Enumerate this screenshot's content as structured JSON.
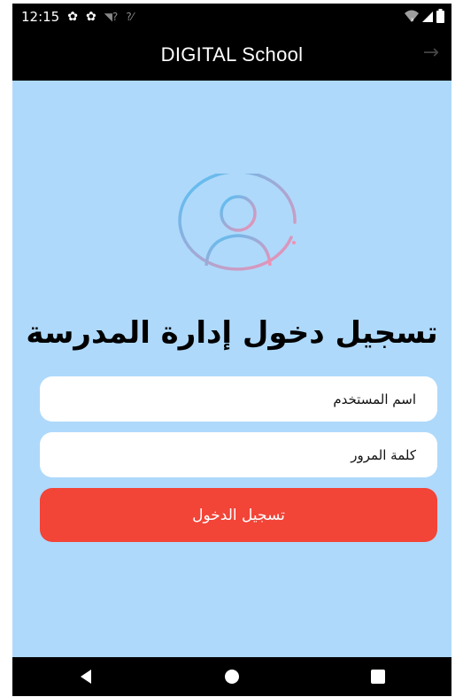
{
  "status_bar": {
    "time": "12:15",
    "icons": [
      "gear-icon",
      "gear-icon",
      "wifi-question-icon",
      "signal-question-icon"
    ],
    "right_icons": [
      "wifi-x-icon",
      "signal-icon",
      "battery-icon"
    ]
  },
  "app_bar": {
    "title": "DIGITAL School",
    "action_icon": "arrow-right-icon"
  },
  "login": {
    "heading": "تسجيل دخول إدارة المدرسة",
    "username_placeholder": "اسم المستخدم",
    "password_placeholder": "كلمة المرور",
    "submit_label": "تسجيل الدخول"
  },
  "colors": {
    "background": "#aed9fb",
    "button": "#f24437",
    "avatar_gradient_start": "#4fc3f7",
    "avatar_gradient_end": "#f48fb1"
  },
  "nav_bar": {
    "buttons": [
      "back-icon",
      "home-icon",
      "recents-icon"
    ]
  }
}
